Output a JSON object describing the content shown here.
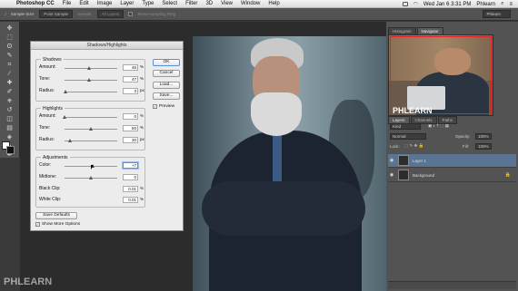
{
  "menubar": {
    "app_name": "Photoshop CC",
    "items": [
      "File",
      "Edit",
      "Image",
      "Layer",
      "Type",
      "Select",
      "Filter",
      "3D",
      "View",
      "Window",
      "Help"
    ],
    "clock": "Wed Jan 6  3:31 PM",
    "user": "Phlearn"
  },
  "options_bar": {
    "sample_size_label": "Sample Size:",
    "sample_size_value": "Point Sample",
    "sample_label": "Sample:",
    "sample_value": "All Layers",
    "show_ring_label": "Show Sampling Ring",
    "workspace": "Phlearn"
  },
  "dialog": {
    "title": "Shadows/Highlights",
    "shadows": {
      "label": "Shadows",
      "amount": {
        "label": "Amount:",
        "value": "46",
        "unit": "%",
        "level": 0.46
      },
      "tone": {
        "label": "Tone:",
        "value": "47",
        "unit": "%",
        "level": 0.47
      },
      "radius": {
        "label": "Radius:",
        "value": "3",
        "unit": "px",
        "level": 0.01
      }
    },
    "highlights": {
      "label": "Highlights",
      "amount": {
        "label": "Amount:",
        "value": "0",
        "unit": "%",
        "level": 0
      },
      "tone": {
        "label": "Tone:",
        "value": "50",
        "unit": "%",
        "level": 0.5
      },
      "radius": {
        "label": "Radius:",
        "value": "30",
        "unit": "px",
        "level": 0.1
      }
    },
    "adjustments": {
      "label": "Adjustments",
      "color": {
        "label": "Color:",
        "value": "+7",
        "level": 0.53
      },
      "midtone": {
        "label": "Midtone:",
        "value": "0",
        "level": 0.5
      },
      "black_clip": {
        "label": "Black Clip:",
        "value": "0.01",
        "unit": "%"
      },
      "white_clip": {
        "label": "White Clip:",
        "value": "0.01",
        "unit": "%"
      }
    },
    "buttons": {
      "ok": "OK",
      "cancel": "Cancel",
      "load": "Load...",
      "save": "Save...",
      "save_defaults": "Save Defaults"
    },
    "preview_label": "Preview",
    "show_more_label": "Show More Options"
  },
  "panels": {
    "navigator_tabs": [
      "Histogram",
      "Navigator"
    ],
    "navigator_logo": "PHLEARN",
    "layers_tabs": [
      "Layers",
      "Channels",
      "Paths"
    ],
    "kind_label": "Kind",
    "blend_mode": "Normal",
    "opacity_label": "Opacity:",
    "opacity_value": "100%",
    "lock_label": "Lock:",
    "fill_label": "Fill:",
    "fill_value": "100%",
    "layers": [
      {
        "name": "Layer 1",
        "selected": true
      },
      {
        "name": "Background",
        "selected": false
      }
    ]
  },
  "watermark": "PHLEARN",
  "colors": {
    "ui_dark": "#535353",
    "selection": "#5a7594",
    "dialog_bg": "#ececec",
    "focus": "#5b8fd6"
  }
}
